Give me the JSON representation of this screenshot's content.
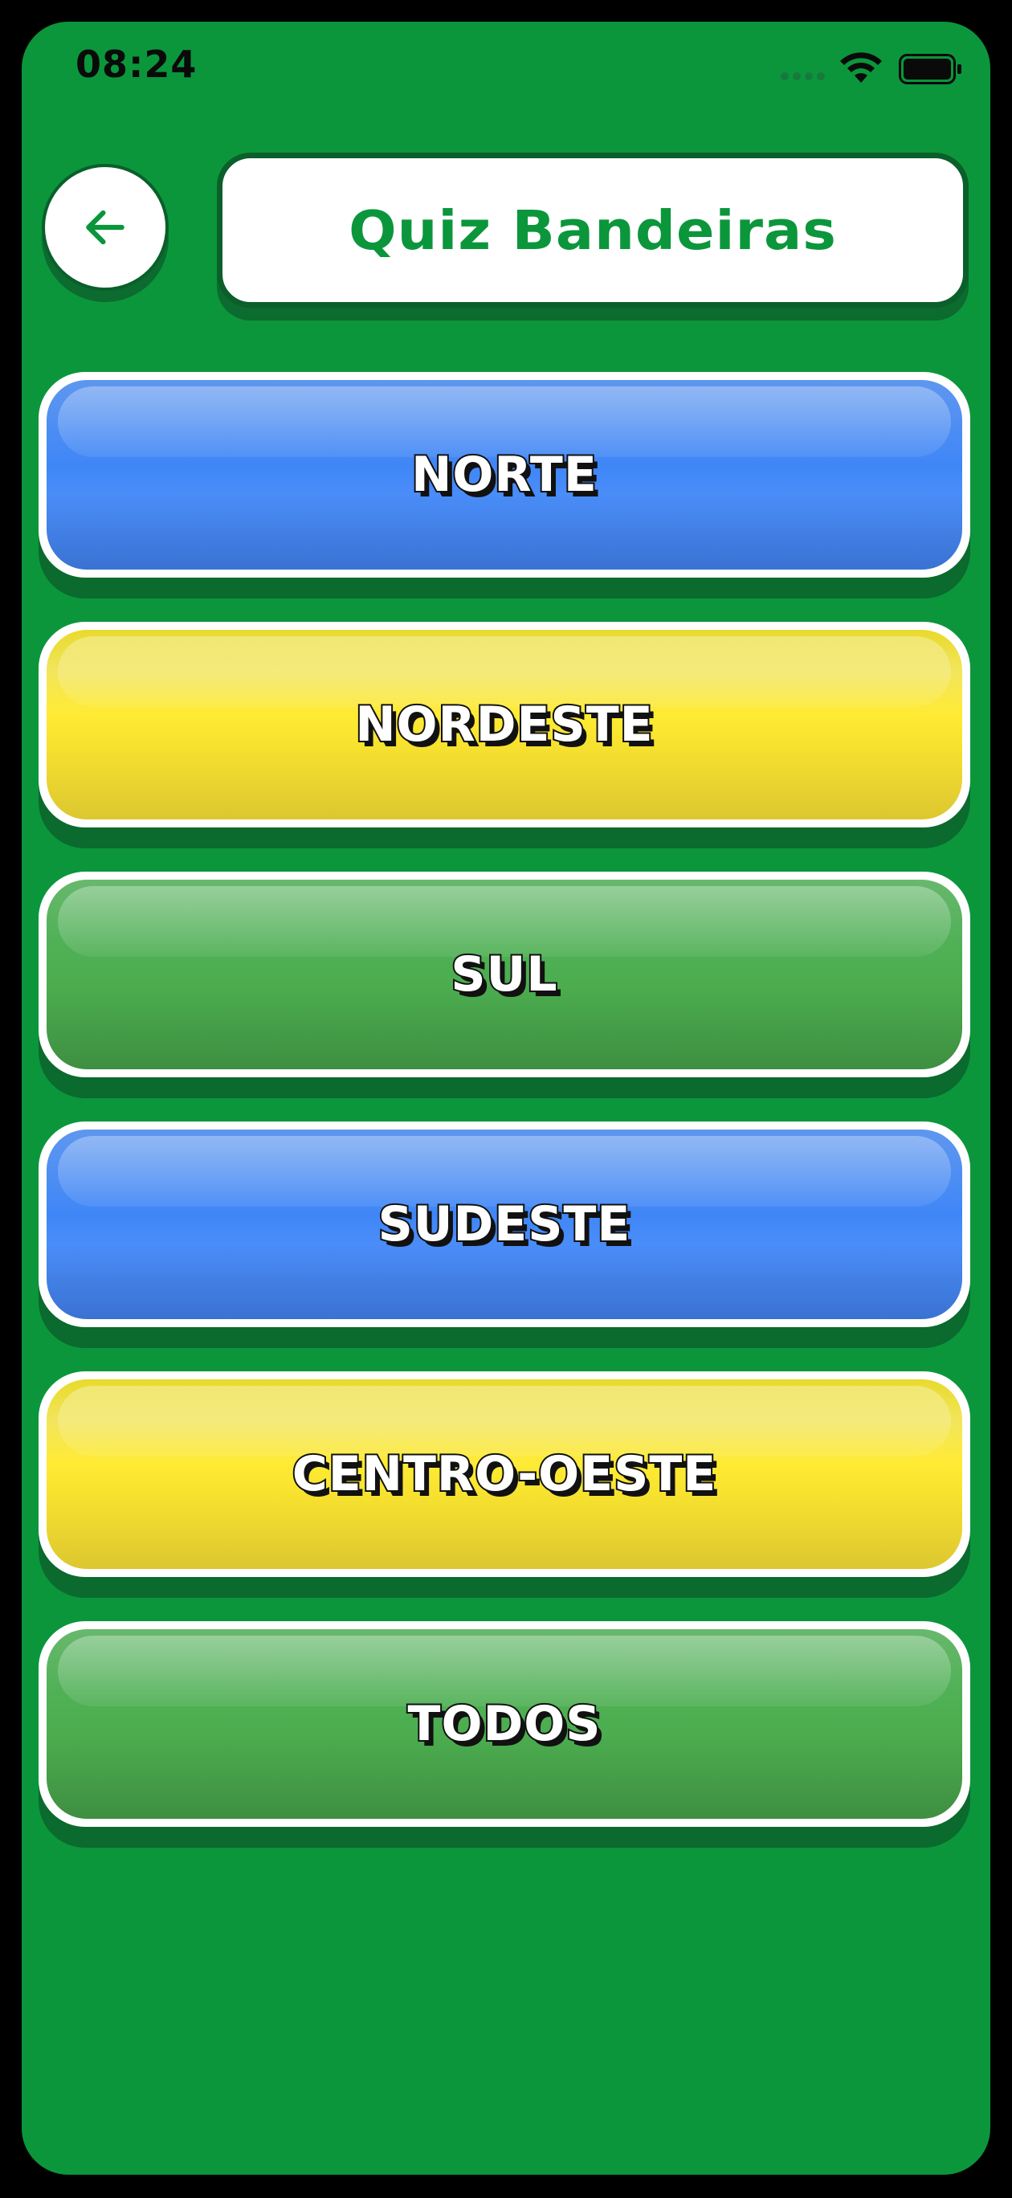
{
  "status_bar": {
    "time": "08:24"
  },
  "header": {
    "title": "Quiz Bandeiras",
    "back_icon": "arrow-left-icon"
  },
  "colors": {
    "background": "#0b963c",
    "accent_green": "#0b963c",
    "blue_button": "#3f86f7",
    "yellow_button": "#ffeb33",
    "green_button": "#4cad4f"
  },
  "regions": [
    {
      "label": "NORTE",
      "color": "blue"
    },
    {
      "label": "NORDESTE",
      "color": "yellow"
    },
    {
      "label": "SUL",
      "color": "green"
    },
    {
      "label": "SUDESTE",
      "color": "blue"
    },
    {
      "label": "CENTRO-OESTE",
      "color": "yellow"
    },
    {
      "label": "TODOS",
      "color": "green"
    }
  ]
}
